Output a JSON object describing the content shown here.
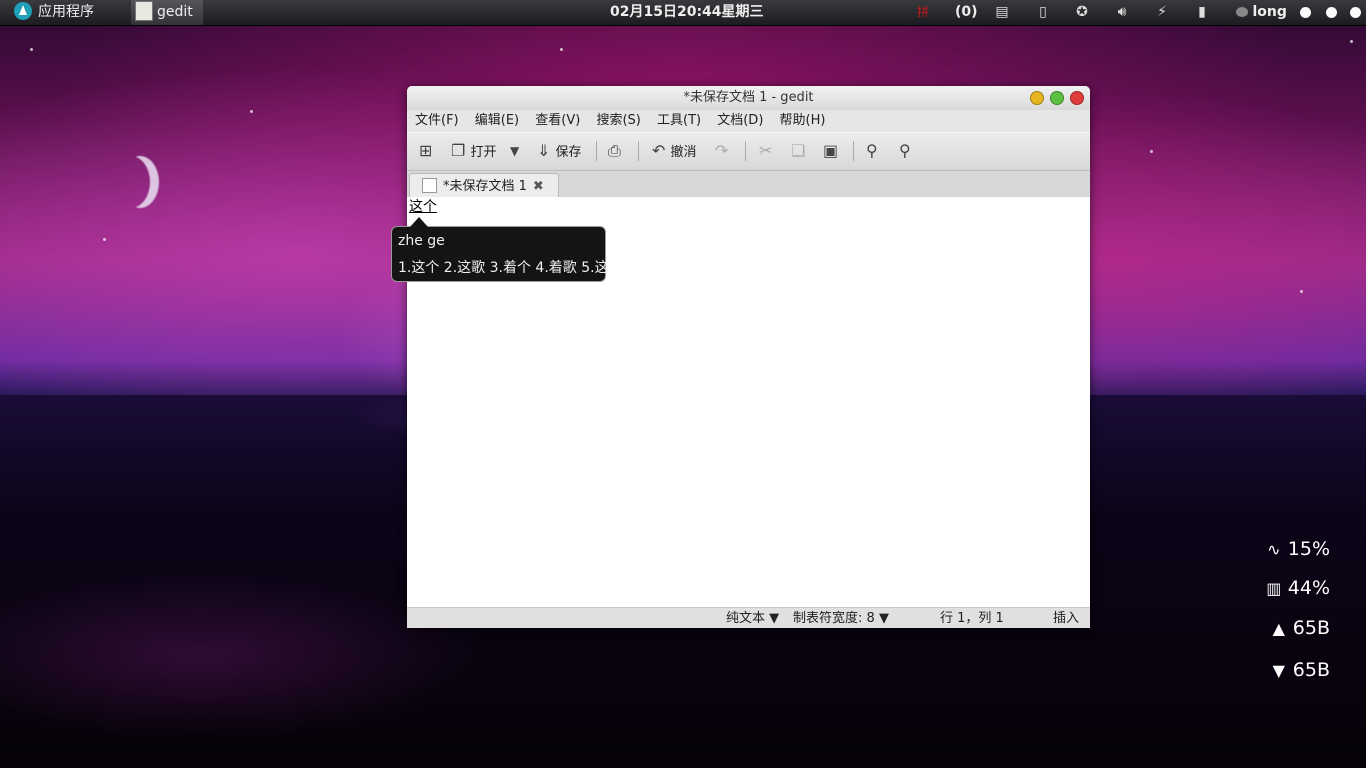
{
  "panel": {
    "apps_label": "应用程序",
    "task_label": "gedit",
    "clock": "02月15日20:44星期三",
    "ime_indicator": "拼",
    "notification_count": "(0)",
    "user": "long"
  },
  "window": {
    "title": "*未保存文档 1 - gedit",
    "menu": [
      "文件(F)",
      "编辑(E)",
      "查看(V)",
      "搜索(S)",
      "工具(T)",
      "文档(D)",
      "帮助(H)"
    ],
    "toolbar": {
      "open_label": "打开",
      "save_label": "保存",
      "undo_label": "撤消"
    },
    "tab_label": "*未保存文档 1",
    "editor_text": "这个",
    "status": {
      "language": "纯文本",
      "tab_width_label": "制表符宽度:",
      "tab_width": "8",
      "position": "行 1，列 1",
      "mode": "插入"
    }
  },
  "ime_popup": {
    "pinyin": "zhe ge",
    "candidates": "1.这个 2.这歌 3.着个 4.着歌 5.这"
  },
  "monitor": {
    "cpu": "15%",
    "memory": "44%",
    "upload": "65B",
    "download": "65B"
  },
  "colors": {
    "close_button": "#e03b3b",
    "minimize_button": "#e8b420",
    "maximize_button": "#5cc040"
  }
}
